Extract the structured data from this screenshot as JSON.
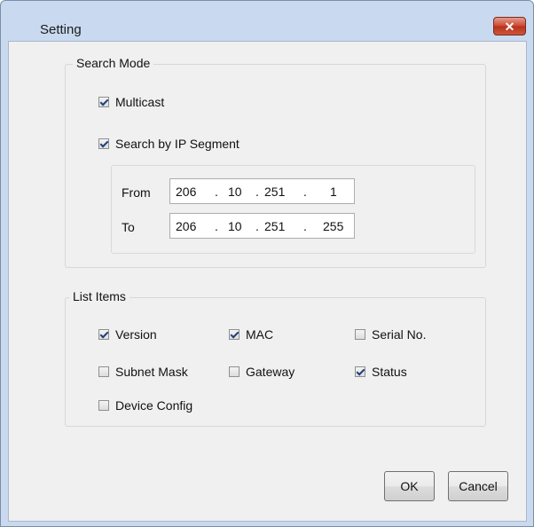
{
  "window": {
    "title": "Setting",
    "close_glyph": "✕"
  },
  "search_mode": {
    "label": "Search Mode",
    "multicast": {
      "label": "Multicast",
      "checked": true
    },
    "ip_segment": {
      "label": "Search by IP Segment",
      "checked": true
    },
    "from_label": "From",
    "to_label": "To",
    "from_ip": [
      "206",
      "10",
      "251",
      "1"
    ],
    "to_ip": [
      "206",
      "10",
      "251",
      "255"
    ],
    "dot": "."
  },
  "list_items": {
    "label": "List Items",
    "items": [
      {
        "label": "Version",
        "checked": true
      },
      {
        "label": "MAC",
        "checked": true
      },
      {
        "label": "Serial No.",
        "checked": false
      },
      {
        "label": "Subnet Mask",
        "checked": false
      },
      {
        "label": "Gateway",
        "checked": false
      },
      {
        "label": "Status",
        "checked": true
      },
      {
        "label": "Device Config",
        "checked": false
      }
    ]
  },
  "buttons": {
    "ok": "OK",
    "cancel": "Cancel"
  }
}
